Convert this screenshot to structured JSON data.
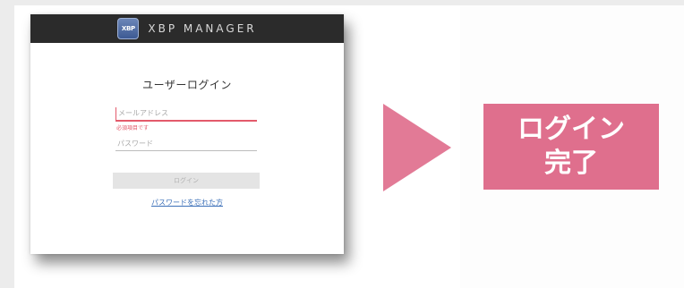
{
  "app": {
    "brand": "XBP MANAGER",
    "logo_text": "XBP"
  },
  "login": {
    "title": "ユーザーログイン",
    "email_placeholder": "メールアドレス",
    "email_error": "必須項目です",
    "password_placeholder": "パスワード",
    "submit_label": "ログイン",
    "forgot_link": "パスワードを忘れた方"
  },
  "result": {
    "line1": "ログイン",
    "line2": "完了"
  },
  "colors": {
    "header": "#2b2b2b",
    "error": "#e35a6b",
    "arrow": "#e27a96",
    "complete_box": "#df6f8d",
    "link": "#3b6fb8"
  },
  "icons": {
    "arrow": "play-triangle-icon",
    "logo": "xbp-logo-icon"
  }
}
